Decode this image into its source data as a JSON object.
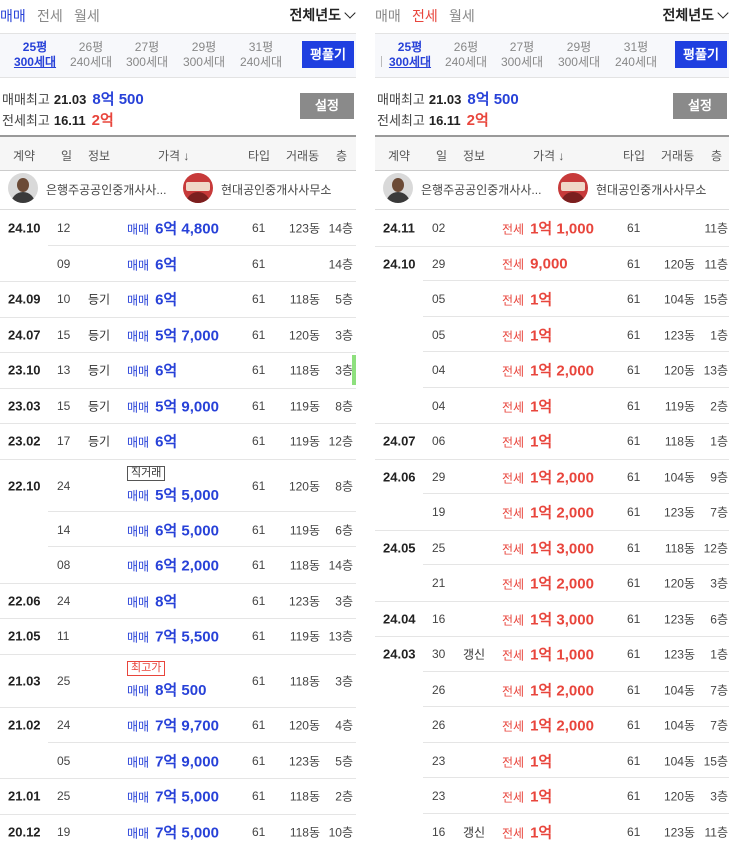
{
  "left": {
    "tabs": [
      "매매",
      "전세",
      "월세"
    ],
    "active_tab": 0,
    "year_select": "전체년도",
    "sizes": [
      {
        "p": "25평",
        "h": "300세대",
        "active": true
      },
      {
        "p": "26평",
        "h": "240세대",
        "active": false
      },
      {
        "p": "27평",
        "h": "300세대",
        "active": false
      },
      {
        "p": "29평",
        "h": "300세대",
        "active": false
      },
      {
        "p": "31평",
        "h": "240세대",
        "active": false
      }
    ],
    "pyeong_button": "평풀기",
    "max_sale": {
      "label": "매매최고",
      "date": "21.03",
      "price": "8억 500"
    },
    "max_jeonse": {
      "label": "전세최고",
      "date": "16.11",
      "price": "2억"
    },
    "settings_button": "설정",
    "headers": {
      "contract": "계약",
      "day": "일",
      "info": "정보",
      "price": "가격 ↓",
      "type": "타입",
      "dong": "거래동",
      "floor": "층"
    },
    "agents": [
      {
        "name": "은행주공공인중개사사...",
        "avatar": "person"
      },
      {
        "name": "현대공인중개사사무소",
        "avatar": "sign"
      }
    ],
    "rows": [
      {
        "ym": "24.10",
        "day": "12",
        "info": "",
        "kind": "매매",
        "price": "6억 4,800",
        "type": "61",
        "dong": "123동",
        "floor": "14층",
        "h": 36,
        "cont": true
      },
      {
        "ym": "",
        "day": "09",
        "info": "",
        "kind": "매매",
        "price": "6억",
        "type": "61",
        "dong": "",
        "floor": "14층",
        "h": 35
      },
      {
        "ym": "24.09",
        "day": "10",
        "info": "등기",
        "kind": "매매",
        "price": "6억",
        "type": "61",
        "dong": "118동",
        "floor": "5층",
        "h": 36
      },
      {
        "ym": "24.07",
        "day": "15",
        "info": "등기",
        "kind": "매매",
        "price": "5억 7,000",
        "type": "61",
        "dong": "120동",
        "floor": "3층",
        "h": 35
      },
      {
        "ym": "23.10",
        "day": "13",
        "info": "등기",
        "kind": "매매",
        "price": "6억",
        "type": "61",
        "dong": "118동",
        "floor": "3층",
        "h": 36,
        "hl": true
      },
      {
        "ym": "23.03",
        "day": "15",
        "info": "등기",
        "kind": "매매",
        "price": "5억 9,000",
        "type": "61",
        "dong": "119동",
        "floor": "8층",
        "h": 35
      },
      {
        "ym": "23.02",
        "day": "17",
        "info": "등기",
        "kind": "매매",
        "price": "6억",
        "type": "61",
        "dong": "119동",
        "floor": "12층",
        "h": 36
      },
      {
        "ym": "22.10",
        "day": "24",
        "info": "",
        "kind": "매매",
        "price": "5억 5,000",
        "type": "61",
        "dong": "120동",
        "floor": "8층",
        "h": 53,
        "badge": "직거래",
        "cont": true
      },
      {
        "ym": "",
        "day": "14",
        "info": "",
        "kind": "매매",
        "price": "6억 5,000",
        "type": "61",
        "dong": "119동",
        "floor": "6층",
        "h": 35,
        "cont": true
      },
      {
        "ym": "",
        "day": "08",
        "info": "",
        "kind": "매매",
        "price": "6억 2,000",
        "type": "61",
        "dong": "118동",
        "floor": "14층",
        "h": 36
      },
      {
        "ym": "22.06",
        "day": "24",
        "info": "",
        "kind": "매매",
        "price": "8억",
        "type": "61",
        "dong": "123동",
        "floor": "3층",
        "h": 35
      },
      {
        "ym": "21.05",
        "day": "11",
        "info": "",
        "kind": "매매",
        "price": "7억 5,500",
        "type": "61",
        "dong": "119동",
        "floor": "13층",
        "h": 36
      },
      {
        "ym": "21.03",
        "day": "25",
        "info": "",
        "kind": "매매",
        "price": "8억 500",
        "type": "61",
        "dong": "118동",
        "floor": "3층",
        "h": 53,
        "badge": "최고가",
        "badge_red": true
      },
      {
        "ym": "21.02",
        "day": "24",
        "info": "",
        "kind": "매매",
        "price": "7억 9,700",
        "type": "61",
        "dong": "120동",
        "floor": "4층",
        "h": 36,
        "cont": true
      },
      {
        "ym": "",
        "day": "05",
        "info": "",
        "kind": "매매",
        "price": "7억 9,000",
        "type": "61",
        "dong": "123동",
        "floor": "5층",
        "h": 35
      },
      {
        "ym": "21.01",
        "day": "25",
        "info": "",
        "kind": "매매",
        "price": "7억 5,000",
        "type": "61",
        "dong": "118동",
        "floor": "2층",
        "h": 36
      },
      {
        "ym": "20.12",
        "day": "19",
        "info": "",
        "kind": "매매",
        "price": "7억 5,000",
        "type": "61",
        "dong": "118동",
        "floor": "10층",
        "h": 35
      }
    ]
  },
  "right": {
    "tabs": [
      "매매",
      "전세",
      "월세"
    ],
    "active_tab": 1,
    "year_select": "전체년도",
    "sizes": [
      {
        "p": "25평",
        "h": "300세대",
        "active": true
      },
      {
        "p": "26평",
        "h": "240세대",
        "active": false
      },
      {
        "p": "27평",
        "h": "300세대",
        "active": false
      },
      {
        "p": "29평",
        "h": "300세대",
        "active": false
      },
      {
        "p": "31평",
        "h": "240세대",
        "active": false
      }
    ],
    "pyeong_button": "평풀기",
    "max_sale": {
      "label": "매매최고",
      "date": "21.03",
      "price": "8억 500"
    },
    "max_jeonse": {
      "label": "전세최고",
      "date": "16.11",
      "price": "2억"
    },
    "settings_button": "설정",
    "headers": {
      "contract": "계약",
      "day": "일",
      "info": "정보",
      "price": "가격 ↓",
      "type": "타입",
      "dong": "거래동",
      "floor": "층"
    },
    "agents": [
      {
        "name": "은행주공공인중개사사...",
        "avatar": "person"
      },
      {
        "name": "현대공인중개사사무소",
        "avatar": "sign"
      }
    ],
    "rows": [
      {
        "ym": "24.11",
        "day": "02",
        "info": "",
        "kind": "전세",
        "price": "1억 1,000",
        "type": "61",
        "dong": "",
        "floor": "11층",
        "h": 36
      },
      {
        "ym": "24.10",
        "day": "29",
        "info": "",
        "kind": "전세",
        "price": "9,000",
        "type": "61",
        "dong": "120동",
        "floor": "11층",
        "h": 35,
        "cont": true
      },
      {
        "ym": "",
        "day": "05",
        "info": "",
        "kind": "전세",
        "price": "1억",
        "type": "61",
        "dong": "104동",
        "floor": "15층",
        "h": 36,
        "cont": true
      },
      {
        "ym": "",
        "day": "05",
        "info": "",
        "kind": "전세",
        "price": "1억",
        "type": "61",
        "dong": "123동",
        "floor": "1층",
        "h": 35,
        "cont": true
      },
      {
        "ym": "",
        "day": "04",
        "info": "",
        "kind": "전세",
        "price": "1억 2,000",
        "type": "61",
        "dong": "120동",
        "floor": "13층",
        "h": 36,
        "cont": true
      },
      {
        "ym": "",
        "day": "04",
        "info": "",
        "kind": "전세",
        "price": "1억",
        "type": "61",
        "dong": "119동",
        "floor": "2층",
        "h": 35
      },
      {
        "ym": "24.07",
        "day": "06",
        "info": "",
        "kind": "전세",
        "price": "1억",
        "type": "61",
        "dong": "118동",
        "floor": "1층",
        "h": 36
      },
      {
        "ym": "24.06",
        "day": "29",
        "info": "",
        "kind": "전세",
        "price": "1억 2,000",
        "type": "61",
        "dong": "104동",
        "floor": "9층",
        "h": 35,
        "cont": true
      },
      {
        "ym": "",
        "day": "19",
        "info": "",
        "kind": "전세",
        "price": "1억 2,000",
        "type": "61",
        "dong": "123동",
        "floor": "7층",
        "h": 36
      },
      {
        "ym": "24.05",
        "day": "25",
        "info": "",
        "kind": "전세",
        "price": "1억 3,000",
        "type": "61",
        "dong": "118동",
        "floor": "12층",
        "h": 35,
        "cont": true
      },
      {
        "ym": "",
        "day": "21",
        "info": "",
        "kind": "전세",
        "price": "1억 2,000",
        "type": "61",
        "dong": "120동",
        "floor": "3층",
        "h": 36
      },
      {
        "ym": "24.04",
        "day": "16",
        "info": "",
        "kind": "전세",
        "price": "1억 3,000",
        "type": "61",
        "dong": "123동",
        "floor": "6층",
        "h": 35
      },
      {
        "ym": "24.03",
        "day": "30",
        "info": "갱신",
        "kind": "전세",
        "price": "1억 1,000",
        "type": "61",
        "dong": "123동",
        "floor": "1층",
        "h": 36,
        "cont": true
      },
      {
        "ym": "",
        "day": "26",
        "info": "",
        "kind": "전세",
        "price": "1억 2,000",
        "type": "61",
        "dong": "104동",
        "floor": "7층",
        "h": 35,
        "cont": true
      },
      {
        "ym": "",
        "day": "26",
        "info": "",
        "kind": "전세",
        "price": "1억 2,000",
        "type": "61",
        "dong": "104동",
        "floor": "7층",
        "h": 36,
        "cont": true
      },
      {
        "ym": "",
        "day": "23",
        "info": "",
        "kind": "전세",
        "price": "1억",
        "type": "61",
        "dong": "104동",
        "floor": "15층",
        "h": 35,
        "cont": true
      },
      {
        "ym": "",
        "day": "23",
        "info": "",
        "kind": "전세",
        "price": "1억",
        "type": "61",
        "dong": "120동",
        "floor": "3층",
        "h": 36,
        "cont": true
      },
      {
        "ym": "",
        "day": "16",
        "info": "갱신",
        "kind": "전세",
        "price": "1억",
        "type": "61",
        "dong": "123동",
        "floor": "11층",
        "h": 35,
        "cont": true
      }
    ]
  }
}
